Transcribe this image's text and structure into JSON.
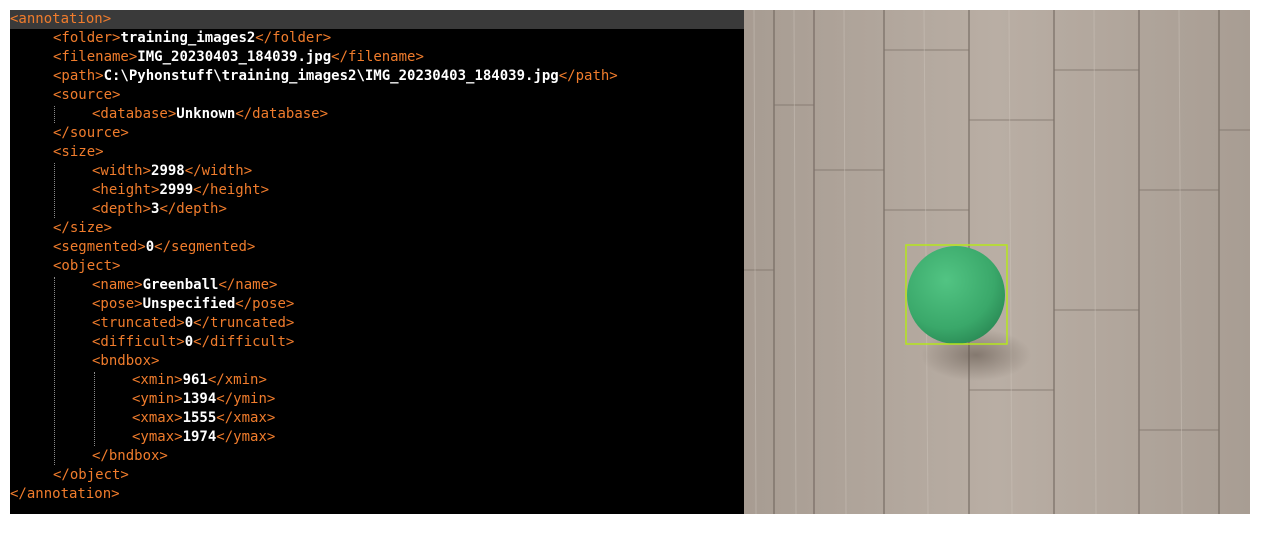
{
  "xml": {
    "annotation_open": "<annotation>",
    "annotation_close": "</annotation>",
    "folder": {
      "open": "<folder>",
      "value": "training_images2",
      "close": "</folder>"
    },
    "filename": {
      "open": "<filename>",
      "value": "IMG_20230403_184039.jpg",
      "close": "</filename>"
    },
    "path": {
      "open": "<path>",
      "value": "C:\\Pyhonstuff\\training_images2\\IMG_20230403_184039.jpg",
      "close": "</path>"
    },
    "source_open": "<source>",
    "database": {
      "open": "<database>",
      "value": "Unknown",
      "close": "</database>"
    },
    "source_close": "</source>",
    "size_open": "<size>",
    "width": {
      "open": "<width>",
      "value": "2998",
      "close": "</width>"
    },
    "height": {
      "open": "<height>",
      "value": "2999",
      "close": "</height>"
    },
    "depth": {
      "open": "<depth>",
      "value": "3",
      "close": "</depth>"
    },
    "size_close": "</size>",
    "segmented": {
      "open": "<segmented>",
      "value": "0",
      "close": "</segmented>"
    },
    "object_open": "<object>",
    "name": {
      "open": "<name>",
      "value": "Greenball",
      "close": "</name>"
    },
    "pose": {
      "open": "<pose>",
      "value": "Unspecified",
      "close": "</pose>"
    },
    "truncated": {
      "open": "<truncated>",
      "value": "0",
      "close": "</truncated>"
    },
    "difficult": {
      "open": "<difficult>",
      "value": "0",
      "close": "</difficult>"
    },
    "bndbox_open": "<bndbox>",
    "xmin": {
      "open": "<xmin>",
      "value": "961",
      "close": "</xmin>"
    },
    "ymin": {
      "open": "<ymin>",
      "value": "1394",
      "close": "</ymin>"
    },
    "xmax": {
      "open": "<xmax>",
      "value": "1555",
      "close": "</xmax>"
    },
    "ymax": {
      "open": "<ymax>",
      "value": "1974",
      "close": "</ymax>"
    },
    "bndbox_close": "</bndbox>",
    "object_close": "</object>"
  },
  "colors": {
    "editor_background": "#000000",
    "tag": "#f07c2c",
    "value": "#ffffff",
    "highlight": "#3a3a3a",
    "bbox": "#b5e61d",
    "ball": "#3daa6c"
  },
  "icons": [
    "wood-floor-photo",
    "green-ball",
    "bounding-box"
  ]
}
